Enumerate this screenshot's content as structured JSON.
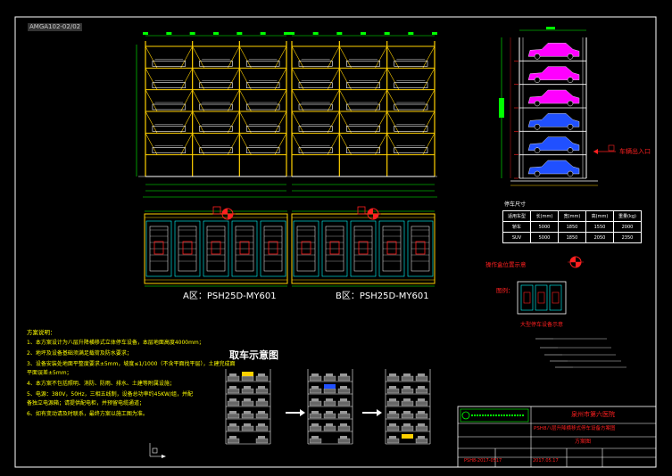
{
  "drawing_code": "AMGA102-02/02",
  "elevation_view": {
    "layout_a_label": "A区：PSH25D-MY601",
    "layout_b_label": "B区：PSH25D-MY601"
  },
  "side_view": {
    "entrance_label": "车辆出入口"
  },
  "spec_table": {
    "title": "停车尺寸",
    "headers": [
      "适用车型",
      "长(mm)",
      "宽(mm)",
      "高(mm)",
      "重量(kg)"
    ],
    "rows": [
      [
        "轿车",
        "5000",
        "1850",
        "1550",
        "2000"
      ],
      [
        "SUV",
        "5000",
        "1850",
        "2050",
        "2350"
      ]
    ]
  },
  "notes_top": {
    "operation_box_label": "操作盒位置示意",
    "legend_text": "图例：",
    "legend_caption": "大型停车设备示意"
  },
  "retrieval_title": "取车示意图",
  "notes": {
    "title": "方案说明：",
    "lines": [
      "1、本方案设计为八层升降横移式立体停车设备，本层地面高度4000mm；",
      "2、地坪及设备基础须满足载荷及防水要求；",
      "3、设备安装处地面平整度要求±5mm，坡度≤1/1000（不含平面找平层），土建完成面",
      "   平面误差±5mm；",
      "4、本方案不包括照明、消防、防雨、排水、土建等附属设施；",
      "5、电源：380V，50Hz，三相五线制，设备总功率约45KW/组，并配",
      "   备独立电源箱；请提供配电柜，并预留电缆通道；",
      "6、如有变动请及时联系，最终方案以施工图为准。"
    ]
  },
  "title_block": {
    "project_name": "泉州市第六医院",
    "drawing_name": "PSH8八层升降横移式停车设备方案图",
    "drawing_type": "方案图",
    "date": "2017.05.17",
    "drawing_no": "PSH8-2017-0517"
  }
}
